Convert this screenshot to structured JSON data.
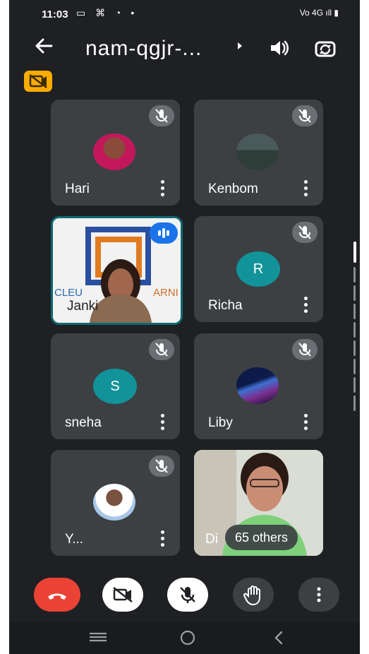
{
  "status_bar": {
    "time": "11:03",
    "notif_icons": "▭ ⌘ ◔ •",
    "right_icons": "Vo 4G ıll ▮"
  },
  "meeting": {
    "title": "nam-qgjr-...",
    "back_icon": "arrow-left-icon",
    "caret_icon": "caret-right-icon",
    "speaker_icon": "speaker-icon",
    "switch_camera_icon": "switch-camera-icon"
  },
  "participants": [
    {
      "name": "Hari",
      "muted": true,
      "avatar": "photo"
    },
    {
      "name": "Kenbom",
      "muted": true,
      "avatar": "photo"
    },
    {
      "name": "Janki",
      "muted": false,
      "speaking": true,
      "video": "on",
      "background_text": "CLEU ARNI"
    },
    {
      "name": "Richa",
      "muted": true,
      "avatar_letter": "R"
    },
    {
      "name": "sneha",
      "muted": true,
      "avatar_letter": "S"
    },
    {
      "name": "Liby",
      "muted": true,
      "avatar": "photo"
    },
    {
      "name": "Y...",
      "muted": true,
      "avatar": "photo"
    },
    {
      "name": "Di",
      "video": "on",
      "others_label": "65 others"
    }
  ],
  "colors": {
    "background": "#1f2023",
    "tile": "#3c4043",
    "end_call": "#ea4335",
    "avatar_teal": "#12939a",
    "camera_off_badge": "#f9ab00",
    "active_border": "#0e6a73"
  },
  "controls": [
    "end-call-icon",
    "camera-off-icon",
    "mic-off-icon",
    "raise-hand-icon",
    "more-vert-icon"
  ],
  "nav": [
    "recents-icon",
    "home-icon",
    "back-icon"
  ]
}
